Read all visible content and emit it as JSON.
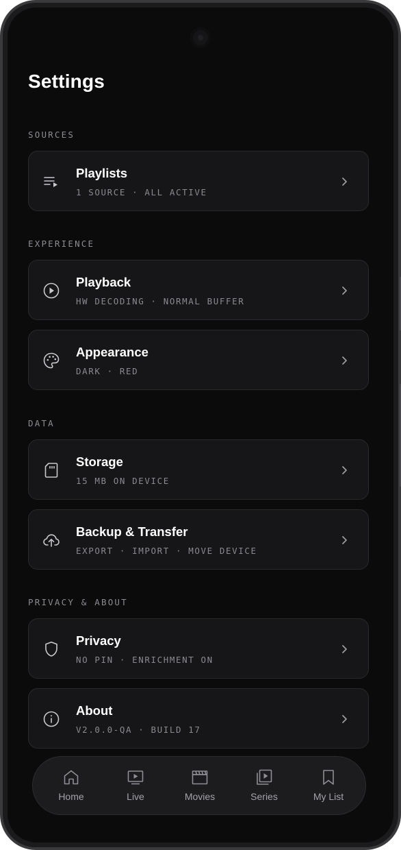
{
  "page": {
    "title": "Settings"
  },
  "sections": [
    {
      "label": "SOURCES"
    },
    {
      "label": "EXPERIENCE"
    },
    {
      "label": "DATA"
    },
    {
      "label": "PRIVACY & ABOUT"
    }
  ],
  "cards": [
    {
      "title": "Playlists",
      "subtitle": "1 SOURCE · ALL ACTIVE",
      "icon": "playlist-icon"
    },
    {
      "title": "Playback",
      "subtitle": "HW DECODING · NORMAL BUFFER",
      "icon": "play-circle-icon"
    },
    {
      "title": "Appearance",
      "subtitle": "DARK · RED",
      "icon": "palette-icon"
    },
    {
      "title": "Storage",
      "subtitle": "15 MB ON DEVICE",
      "icon": "sd-card-icon"
    },
    {
      "title": "Backup & Transfer",
      "subtitle": "EXPORT · IMPORT · MOVE DEVICE",
      "icon": "cloud-upload-icon"
    },
    {
      "title": "Privacy",
      "subtitle": "NO PIN · ENRICHMENT ON",
      "icon": "shield-icon"
    },
    {
      "title": "About",
      "subtitle": "V2.0.0-QA · BUILD 17",
      "icon": "info-icon"
    }
  ],
  "nav": [
    {
      "label": "Home",
      "icon": "home-icon"
    },
    {
      "label": "Live",
      "icon": "live-tv-icon"
    },
    {
      "label": "Movies",
      "icon": "clapperboard-icon"
    },
    {
      "label": "Series",
      "icon": "series-icon"
    },
    {
      "label": "My List",
      "icon": "bookmark-icon"
    }
  ],
  "colors": {
    "background": "#0b0b0c",
    "card": "#161618",
    "text": "#ffffff",
    "muted": "#8a8a90"
  }
}
